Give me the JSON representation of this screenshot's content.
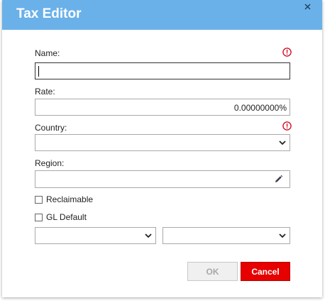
{
  "dialog": {
    "title": "Tax Editor",
    "close_icon": "close-icon"
  },
  "form": {
    "name": {
      "label": "Name:",
      "value": "",
      "required_icon": "error-icon"
    },
    "rate": {
      "label": "Rate:",
      "value": "0.00000000%"
    },
    "country": {
      "label": "Country:",
      "value": "",
      "required_icon": "error-icon"
    },
    "region": {
      "label": "Region:",
      "value": "",
      "edit_icon": "pencil-icon"
    },
    "reclaimable": {
      "label": "Reclaimable",
      "checked": false
    },
    "gl_default": {
      "label": "GL Default",
      "checked": false
    },
    "gl_select_1": {
      "value": ""
    },
    "gl_select_2": {
      "value": ""
    }
  },
  "buttons": {
    "ok_label": "OK",
    "cancel_label": "Cancel"
  },
  "colors": {
    "titlebar": "#6ab1ea",
    "error": "#d0021b",
    "cancel": "#e60000"
  }
}
